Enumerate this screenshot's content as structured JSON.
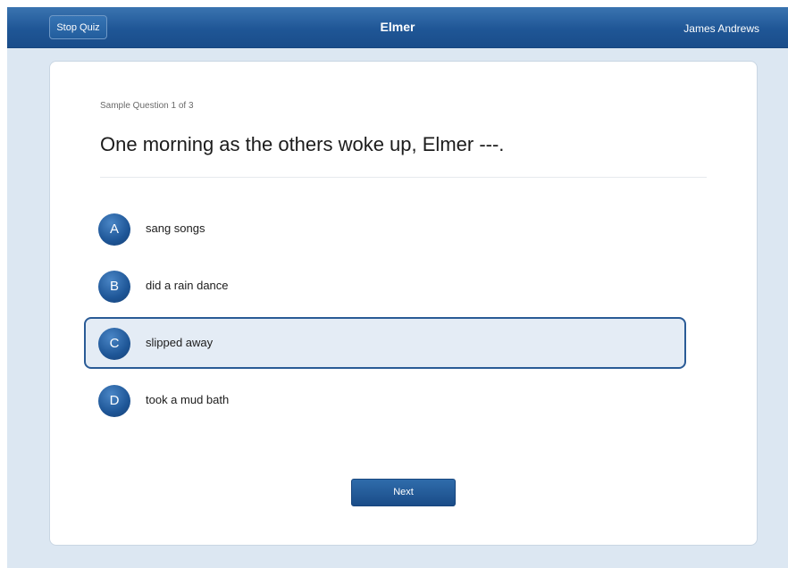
{
  "header": {
    "stop_label": "Stop Quiz",
    "title": "Elmer",
    "user_name": "James Andrews"
  },
  "quiz": {
    "counter": "Sample Question 1 of 3",
    "question": "One morning as the others woke up, Elmer ---.",
    "options": [
      {
        "letter": "A",
        "text": "sang songs",
        "selected": false
      },
      {
        "letter": "B",
        "text": "did a rain dance",
        "selected": false
      },
      {
        "letter": "C",
        "text": "slipped away",
        "selected": true
      },
      {
        "letter": "D",
        "text": "took a mud bath",
        "selected": false
      }
    ],
    "next_label": "Next"
  },
  "colors": {
    "header_blue": "#1f5696",
    "selected_bg": "#e4ecf5",
    "selected_border": "#2a5b96",
    "page_bg": "#dce7f2"
  }
}
